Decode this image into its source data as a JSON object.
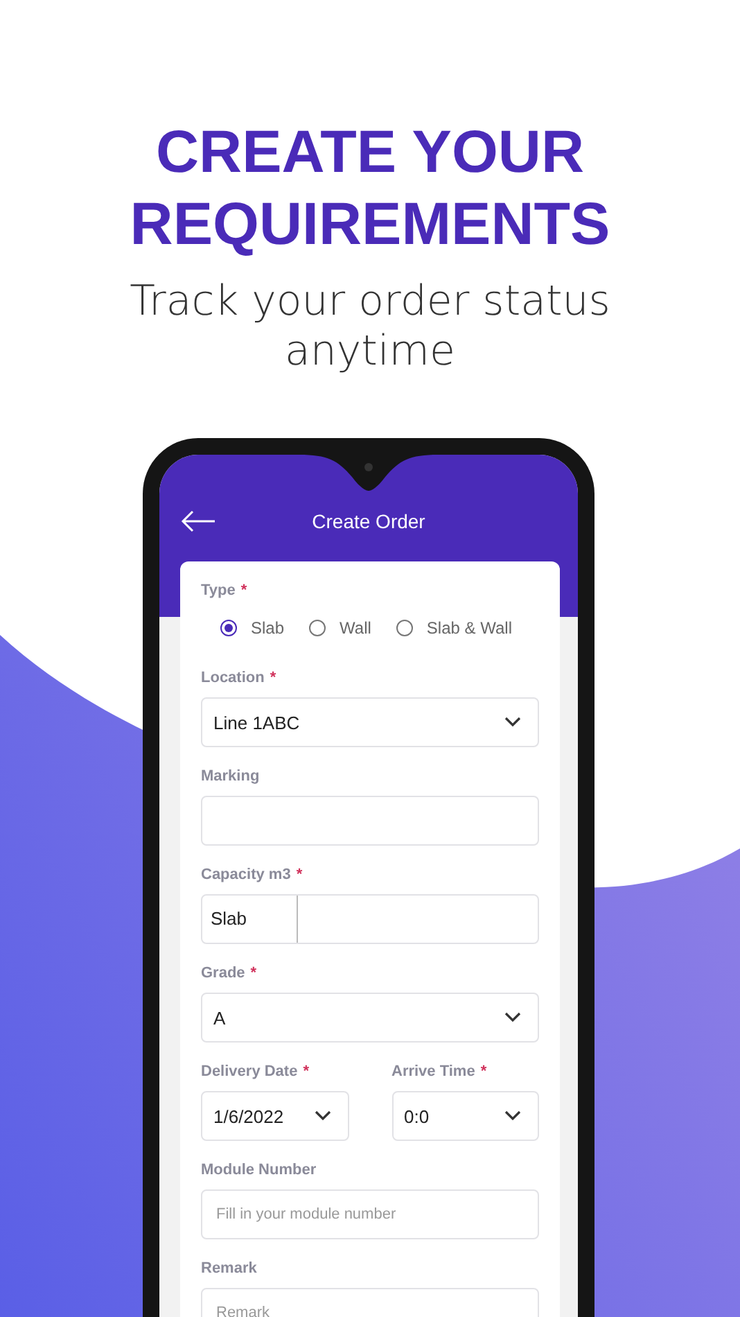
{
  "header": {
    "title_lines": [
      "CREATE YOUR",
      "REQUIREMENTS"
    ],
    "subtitle": "Track your order status anytime"
  },
  "app_bar": {
    "title": "Create Order"
  },
  "form": {
    "type": {
      "label": "Type",
      "required_mark": "*",
      "options": [
        {
          "label": "Slab",
          "selected": true
        },
        {
          "label": "Wall",
          "selected": false
        },
        {
          "label": "Slab & Wall",
          "selected": false
        }
      ]
    },
    "fields": [
      {
        "kind": "select",
        "label": "Location",
        "required_mark": "*",
        "value": "Line 1ABC"
      },
      {
        "kind": "text",
        "label": "Marking"
      },
      {
        "kind": "prefixed",
        "label": "Capacity m3",
        "required_mark": "*",
        "prefix": "Slab"
      },
      {
        "kind": "select",
        "label": "Grade",
        "required_mark": "*",
        "value": "A"
      },
      {
        "kind": "pair",
        "items": [
          {
            "kind": "select",
            "label": "Delivery Date",
            "required_mark": "*",
            "value": "1/6/2022"
          },
          {
            "kind": "select",
            "label": "Arrive Time",
            "required_mark": "*",
            "value": "0:0"
          }
        ]
      },
      {
        "kind": "text",
        "label": "Module Number",
        "placeholder": "Fill in your module number"
      },
      {
        "kind": "text",
        "label": "Remark",
        "placeholder": "Remark"
      }
    ]
  }
}
